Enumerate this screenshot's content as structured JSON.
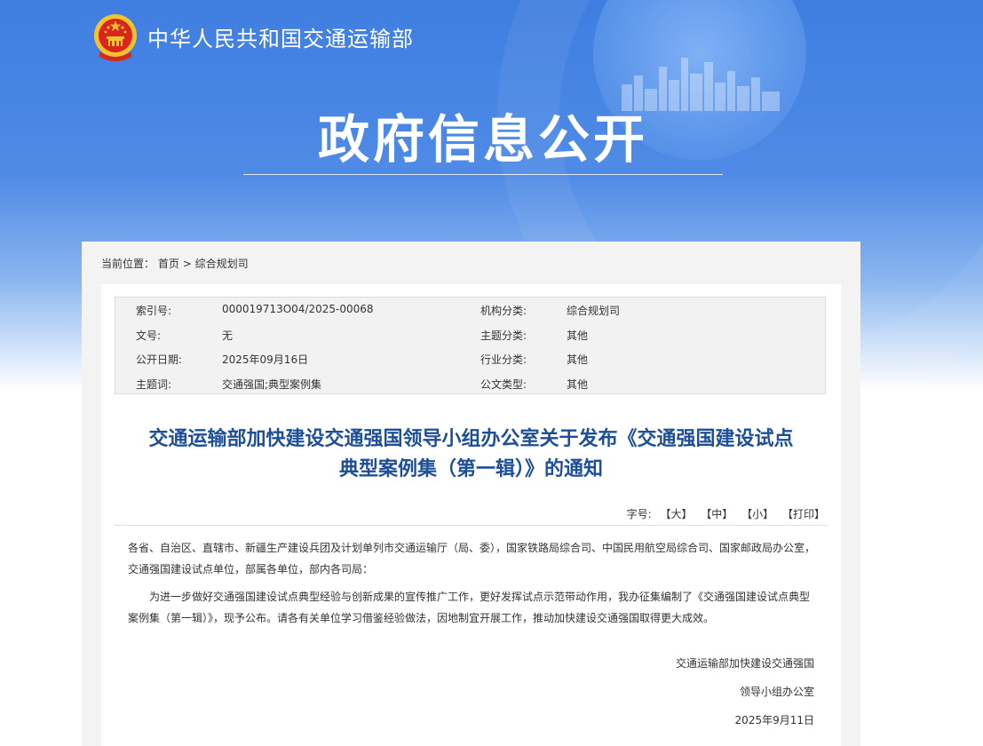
{
  "header": {
    "ministry_name": "中华人民共和国交通运输部",
    "section_title": "政府信息公开",
    "emblem_icon": "national-emblem-icon"
  },
  "breadcrumb": {
    "prefix": "当前位置：",
    "home": "首页",
    "separator": ">",
    "current": "综合规划司"
  },
  "meta": {
    "index_label": "索引号:",
    "index_value": "000019713O04/2025-00068",
    "org_label": "机构分类:",
    "org_value": "综合规划司",
    "doc_no_label": "文号:",
    "doc_no_value": "无",
    "topic_label": "主题分类:",
    "topic_value": "其他",
    "date_label": "公开日期:",
    "date_value": "2025年09月16日",
    "industry_label": "行业分类:",
    "industry_value": "其他",
    "keywords_label": "主题词:",
    "keywords_value": "交通强国;典型案例集",
    "type_label": "公文类型:",
    "type_value": "其他"
  },
  "document": {
    "title_line1": "交通运输部加快建设交通强国领导小组办公室关于发布《交通强国建设试点",
    "title_line2": "典型案例集（第一辑）》的通知",
    "font_size_label": "字号:",
    "font_large": "【大】",
    "font_medium": "【中】",
    "font_small": "【小】",
    "print": "【打印】",
    "recipients": "各省、自治区、直辖市、新疆生产建设兵团及计划单列市交通运输厅（局、委），国家铁路局综合司、中国民用航空局综合司、国家邮政局办公室，交通强国建设试点单位，部属各单位，部内各司局：",
    "body": "为进一步做好交通强国建设试点典型经验与创新成果的宣传推广工作，更好发挥试点示范带动作用，我办征集编制了《交通强国建设试点典型案例集（第一辑）》，现予公布。请各有关单位学习借鉴经验做法，因地制宜开展工作，推动加快建设交通强国取得更大成效。",
    "signature_line1": "交通运输部加快建设交通强国",
    "signature_line2": "领导小组办公室",
    "signature_date": "2025年9月11日"
  },
  "colors": {
    "hero_blue": "#3f7ee0",
    "title_blue": "#1d4f98",
    "panel_gray": "#f3f3f3"
  }
}
